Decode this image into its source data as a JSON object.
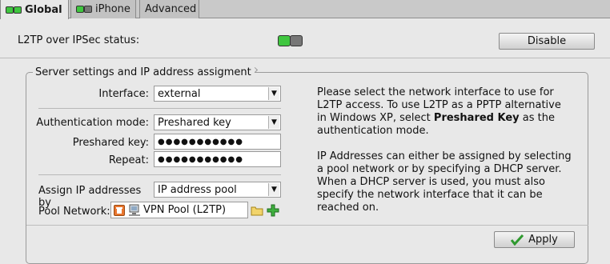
{
  "tabs": [
    {
      "label": "Global",
      "active": true
    },
    {
      "label": "iPhone",
      "active": false
    },
    {
      "label": "Advanced",
      "active": false
    }
  ],
  "status": {
    "label": "L2TP over IPSec status:",
    "toggle_label": "Disable"
  },
  "group": {
    "legend": "Server settings and IP address assigment",
    "interface_label": "Interface:",
    "interface_value": "external",
    "auth_label": "Authentication mode:",
    "auth_value": "Preshared key",
    "psk_label": "Preshared key:",
    "psk_value": "●●●●●●●●●●●",
    "repeat_label": "Repeat:",
    "repeat_value": "●●●●●●●●●●●",
    "assign_label": "Assign IP addresses by",
    "assign_value": "IP address pool",
    "pool_label": "Pool Network:",
    "pool_value": "VPN Pool (L2TP)",
    "desc1_a": "Please select the network interface to use for L2TP access. To use L2TP as a PPTP alternative in Windows XP, select ",
    "desc1_b": "Preshared Key",
    "desc1_c": " as the authentication mode.",
    "desc2": "IP Addresses can either be assigned by selecting a pool network or by specifying a DHCP server. When a DHCP server is used, you must also specify the network interface that it can be reached on."
  },
  "apply_label": "Apply",
  "colors": {
    "accent_green": "#3fc63f"
  }
}
